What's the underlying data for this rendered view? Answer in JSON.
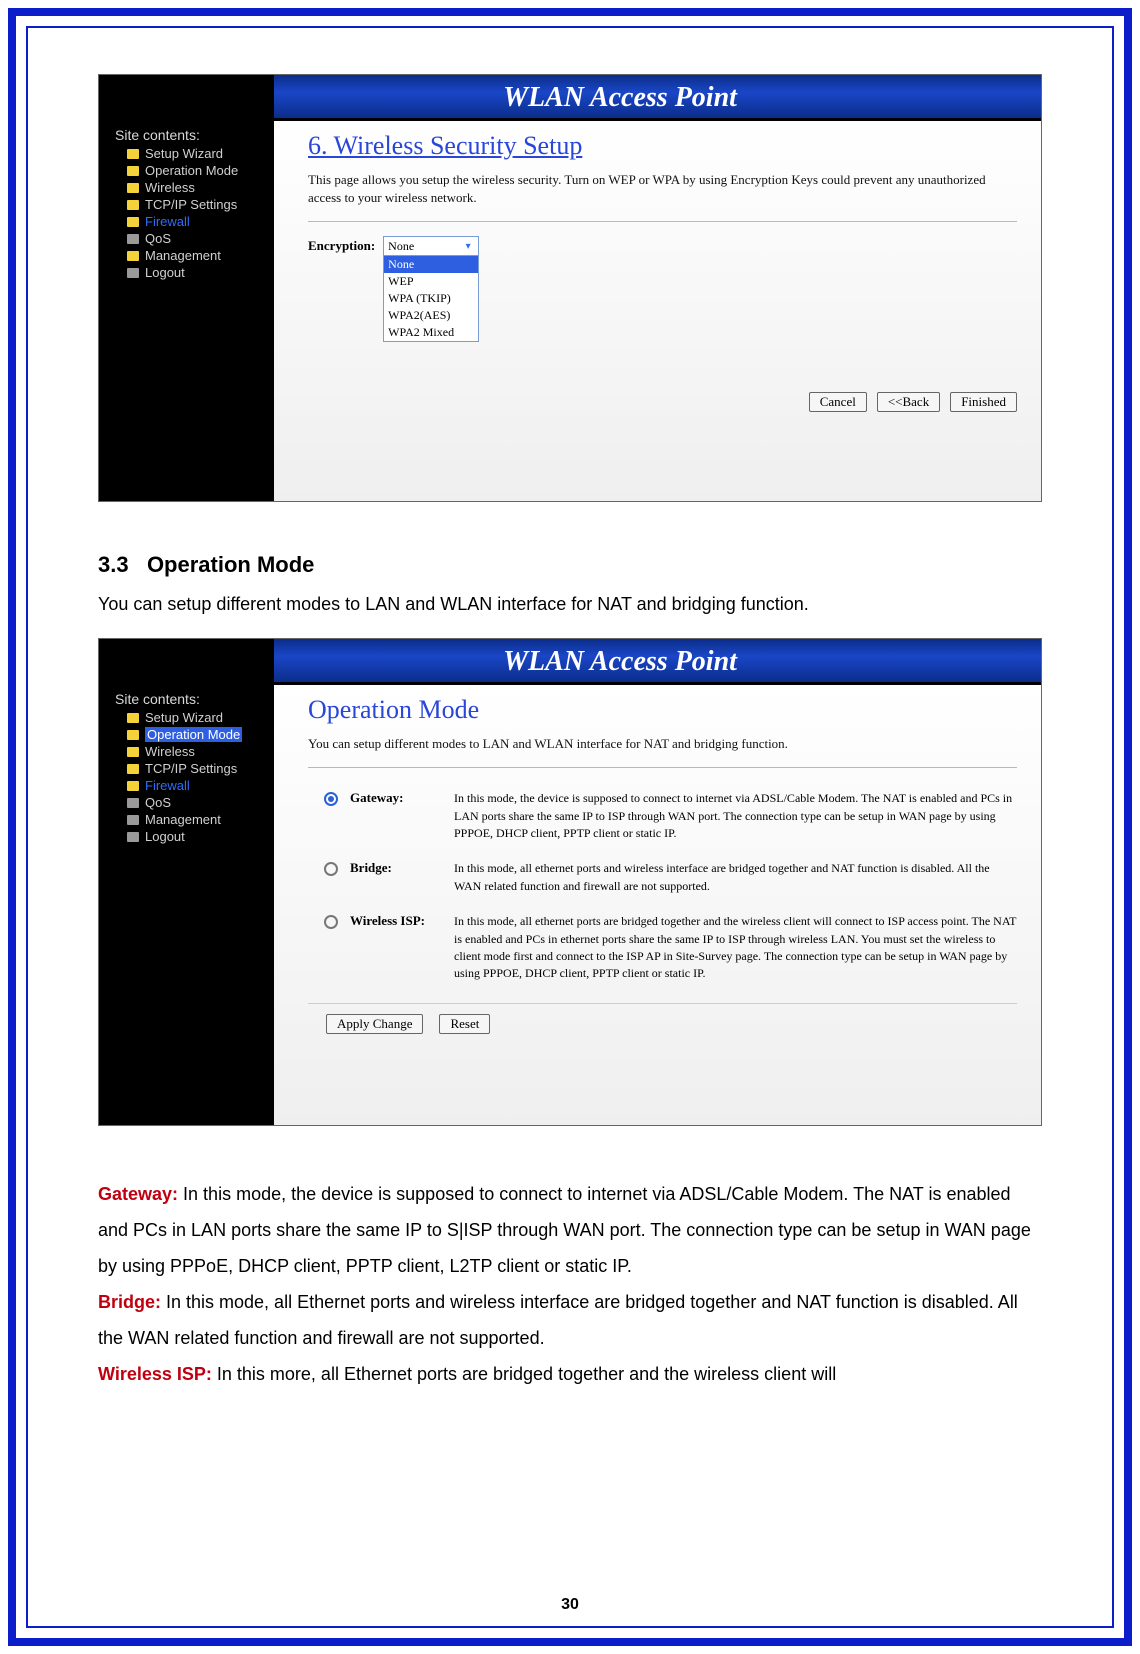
{
  "router_title": "WLAN Access Point",
  "panel1": {
    "sidebar_title": "Site contents:",
    "nav": [
      {
        "label": "Setup Wizard"
      },
      {
        "label": "Operation Mode"
      },
      {
        "label": "Wireless"
      },
      {
        "label": "TCP/IP Settings"
      },
      {
        "label": "Firewall",
        "highlight": true
      },
      {
        "label": "QoS",
        "gray": true
      },
      {
        "label": "Management"
      },
      {
        "label": "Logout",
        "gray": true
      }
    ],
    "title": "6. Wireless Security Setup",
    "desc": "This page allows you setup the wireless security. Turn on WEP or WPA by using Encryption Keys could prevent any unauthorized access to your wireless network.",
    "encryption_label": "Encryption:",
    "dropdown": {
      "selected": "None",
      "options": [
        "None",
        "WEP",
        "WPA (TKIP)",
        "WPA2(AES)",
        "WPA2 Mixed"
      ]
    },
    "buttons": {
      "cancel": "Cancel",
      "back": "<<Back",
      "finished": "Finished"
    }
  },
  "doc": {
    "section_number": "3.3",
    "section_title": "Operation Mode",
    "intro": "You can setup different modes to LAN and WLAN interface for NAT and bridging function."
  },
  "panel2": {
    "sidebar_title": "Site contents:",
    "nav": [
      {
        "label": "Setup Wizard"
      },
      {
        "label": "Operation Mode",
        "selected": true
      },
      {
        "label": "Wireless"
      },
      {
        "label": "TCP/IP Settings"
      },
      {
        "label": "Firewall",
        "highlight": true
      },
      {
        "label": "QoS",
        "gray": true
      },
      {
        "label": "Management",
        "gray": true
      },
      {
        "label": "Logout",
        "gray": true
      }
    ],
    "title": "Operation Mode",
    "desc": "You can setup different modes to LAN and WLAN interface for NAT and bridging function.",
    "modes": [
      {
        "label": "Gateway:",
        "checked": true,
        "desc": "In this mode, the device is supposed to connect to internet via ADSL/Cable Modem. The NAT is enabled and PCs in LAN ports share the same IP to ISP through WAN port. The connection type can be setup in WAN page by using PPPOE, DHCP client, PPTP client or static IP."
      },
      {
        "label": "Bridge:",
        "checked": false,
        "desc": "In this mode, all ethernet ports and wireless interface are bridged together and NAT function is disabled. All the WAN related function and firewall are not supported."
      },
      {
        "label": "Wireless ISP:",
        "checked": false,
        "desc": "In this mode, all ethernet ports are bridged together and the wireless client will connect to ISP access point. The NAT is enabled and PCs in ethernet ports share the same IP to ISP through wireless LAN. You must set the wireless to client mode first and connect to the ISP AP in Site-Survey page. The connection type can be setup in WAN page by using PPPOE, DHCP client, PPTP client or static IP."
      }
    ],
    "buttons": {
      "apply": "Apply Change",
      "reset": "Reset"
    }
  },
  "bodytext": {
    "gateway_label": "Gateway:",
    "gateway": " In this mode, the device is supposed to connect to internet via ADSL/Cable Modem. The NAT is enabled and PCs in LAN ports share the same IP to S|ISP through WAN port. The connection type can be setup in WAN page by using PPPoE, DHCP client, PPTP client, L2TP client or static IP.",
    "bridge_label": "Bridge:",
    "bridge": " In this mode, all Ethernet ports and wireless interface are bridged together and NAT function is disabled. All the WAN related function and firewall are not supported.",
    "wisp_label": "Wireless ISP:",
    "wisp": " In this more, all Ethernet ports are bridged together and the wireless client will"
  },
  "page_number": "30"
}
